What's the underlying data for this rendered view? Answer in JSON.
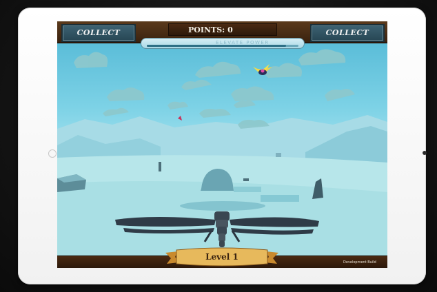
{
  "hud": {
    "collect_left": "COLLECT",
    "collect_right": "COLLECT",
    "points_label": "POINTS: 0",
    "power_label": "ELEVATE POWER",
    "power_level": 0.92
  },
  "footer": {
    "level_label": "Level 1",
    "build_label": "Development Build"
  },
  "colors": {
    "sky": "#7dd2e6",
    "hud_wood": "#5b3a1c",
    "collect_button": "#3d6272",
    "banner_gold": "#e7b95c"
  },
  "icons": {
    "player": "dragonfly",
    "enemy": "flying-bug"
  }
}
